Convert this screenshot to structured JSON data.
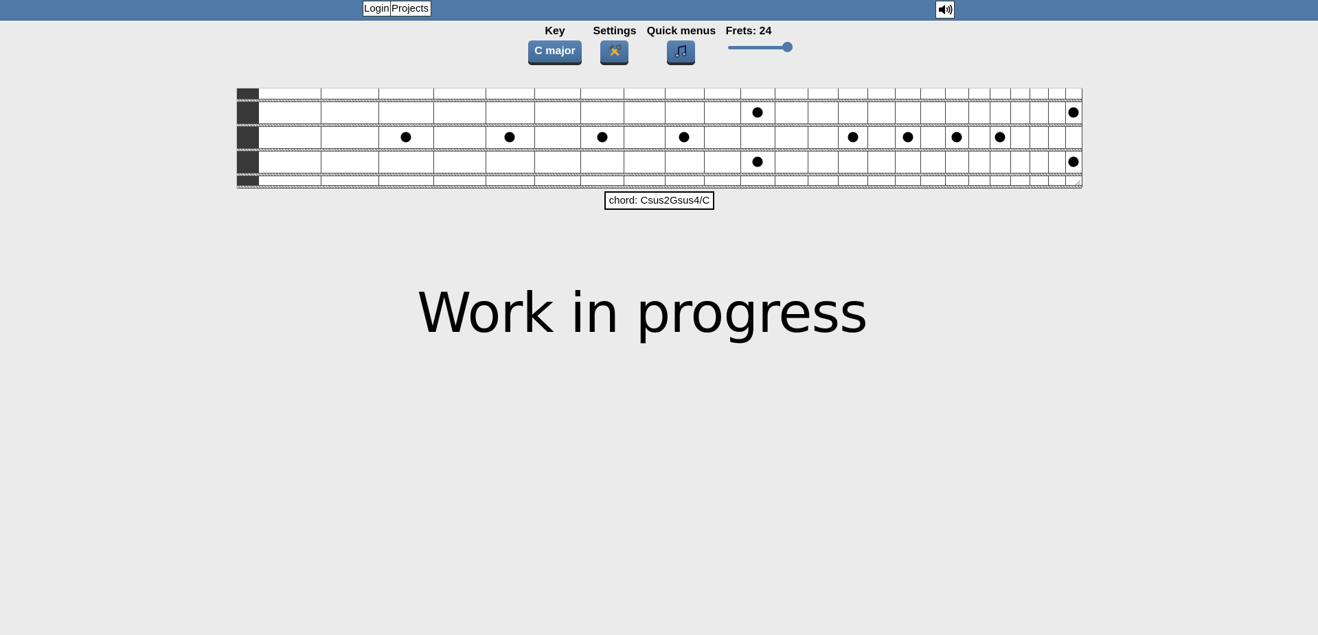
{
  "nav": {
    "login_label": "Login",
    "projects_label": "Projects"
  },
  "icons": {
    "sound": "speaker-volume-icon",
    "settings": "hammer-wrench-icon",
    "quick_menus": "music-note-icon"
  },
  "colors": {
    "bar": "#4f79a7",
    "button": "#4f79a7",
    "background": "#ebebeb"
  },
  "controls": {
    "key": {
      "label": "Key",
      "value": "C major"
    },
    "settings": {
      "label": "Settings"
    },
    "quick_menus": {
      "label": "Quick menus"
    },
    "frets": {
      "label": "Frets: 24",
      "min": 0,
      "max": 24,
      "value": 24
    }
  },
  "fretboard": {
    "strings": 6,
    "frets": 24,
    "notes": [
      {
        "string": 2,
        "fret": 11
      },
      {
        "string": 2,
        "fret": 24
      },
      {
        "string": 3,
        "fret": 3
      },
      {
        "string": 3,
        "fret": 5
      },
      {
        "string": 3,
        "fret": 7
      },
      {
        "string": 3,
        "fret": 9
      },
      {
        "string": 3,
        "fret": 14
      },
      {
        "string": 3,
        "fret": 16
      },
      {
        "string": 3,
        "fret": 18
      },
      {
        "string": 3,
        "fret": 20
      },
      {
        "string": 4,
        "fret": 11
      },
      {
        "string": 4,
        "fret": 24
      }
    ]
  },
  "chord_display": "chord: Csus2Gsus4/C",
  "main": {
    "heading": "Work in progress"
  }
}
